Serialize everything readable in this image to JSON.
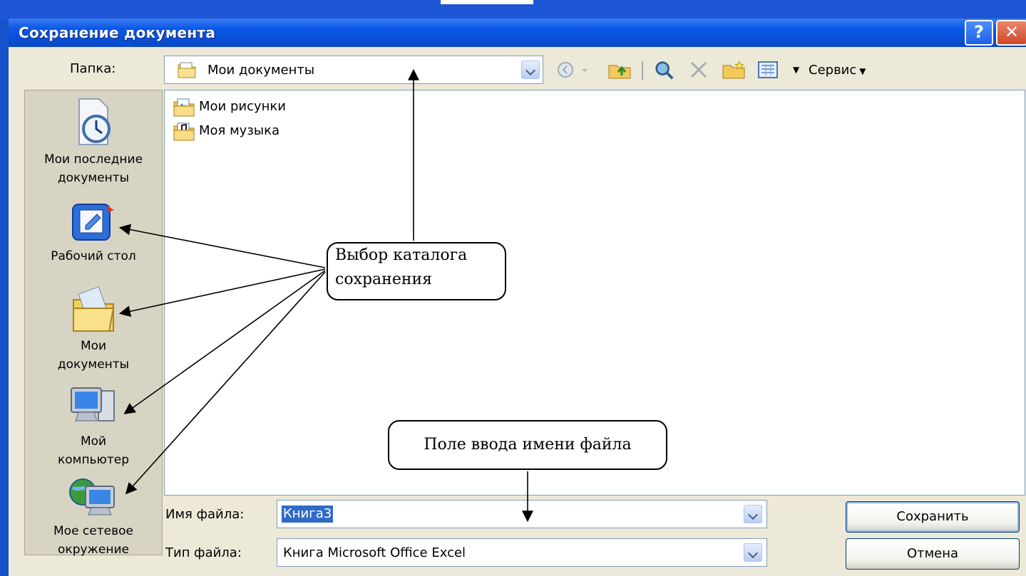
{
  "window": {
    "title": "Сохранение документа",
    "help_label": "?",
    "close_label": "✕"
  },
  "folder_bar": {
    "label": "Папка:",
    "value": "Мои документы",
    "service_label": "Сервис"
  },
  "places": [
    {
      "label_line1": "Мои последние",
      "label_line2": "документы",
      "icon": "recent-documents-icon"
    },
    {
      "label_line1": "Рабочий стол",
      "label_line2": "",
      "icon": "desktop-icon"
    },
    {
      "label_line1": "Мои",
      "label_line2": "документы",
      "icon": "my-documents-icon"
    },
    {
      "label_line1": "Мой",
      "label_line2": "компьютер",
      "icon": "my-computer-icon"
    },
    {
      "label_line1": "Мое сетевое",
      "label_line2": "окружение",
      "icon": "network-places-icon"
    }
  ],
  "files": [
    {
      "name": "Мои рисунки",
      "icon": "pictures-folder-icon"
    },
    {
      "name": "Моя музыка",
      "icon": "music-folder-icon"
    }
  ],
  "filename": {
    "label": "Имя файла:",
    "value": "Книга3"
  },
  "filetype": {
    "label": "Тип файла:",
    "value": "Книга Microsoft Office Excel"
  },
  "buttons": {
    "save": "Сохранить",
    "cancel": "Отмена"
  },
  "callouts": {
    "folder_line1": "Выбор каталога",
    "folder_line2": "сохранения",
    "filename": "Поле ввода имени файла"
  },
  "colors": {
    "titlebar": "#0b57e8",
    "dialog_bg": "#ece9d8",
    "selection": "#316ac5",
    "desktop": "#1652c9"
  }
}
